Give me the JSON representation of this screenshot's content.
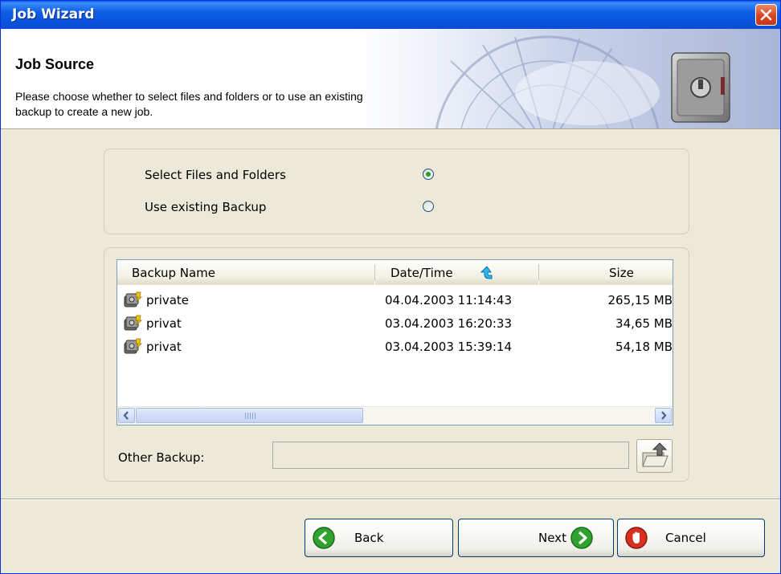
{
  "window": {
    "title": "Job Wizard",
    "close_icon": "close-icon"
  },
  "header": {
    "title": "Job Source",
    "description": "Please choose whether to select files and folders or to use an existing backup to create a new job.",
    "art_icon": "safe-icon"
  },
  "source_options": [
    {
      "label": "Select Files and Folders",
      "selected": true
    },
    {
      "label": "Use existing Backup",
      "selected": false
    }
  ],
  "backup_list": {
    "columns": {
      "name": "Backup Name",
      "date": "Date/Time",
      "size": "Size"
    },
    "sort_icon": "sort-arrow-icon",
    "rows": [
      {
        "name": "private",
        "date": "04.04.2003 11:14:43",
        "size": "265,15 MB"
      },
      {
        "name": "privat",
        "date": "03.04.2003 16:20:33",
        "size": "34,65 MB"
      },
      {
        "name": "privat",
        "date": "03.04.2003 15:39:14",
        "size": "54,18 MB"
      }
    ]
  },
  "other_backup": {
    "label": "Other Backup:",
    "value": ""
  },
  "buttons": {
    "back": "Back",
    "next": "Next",
    "cancel": "Cancel"
  },
  "colors": {
    "titlebar": "#0a54df",
    "dialog_bg": "#ece9d8",
    "button_green": "#2fa22f",
    "button_red": "#d7301e"
  }
}
